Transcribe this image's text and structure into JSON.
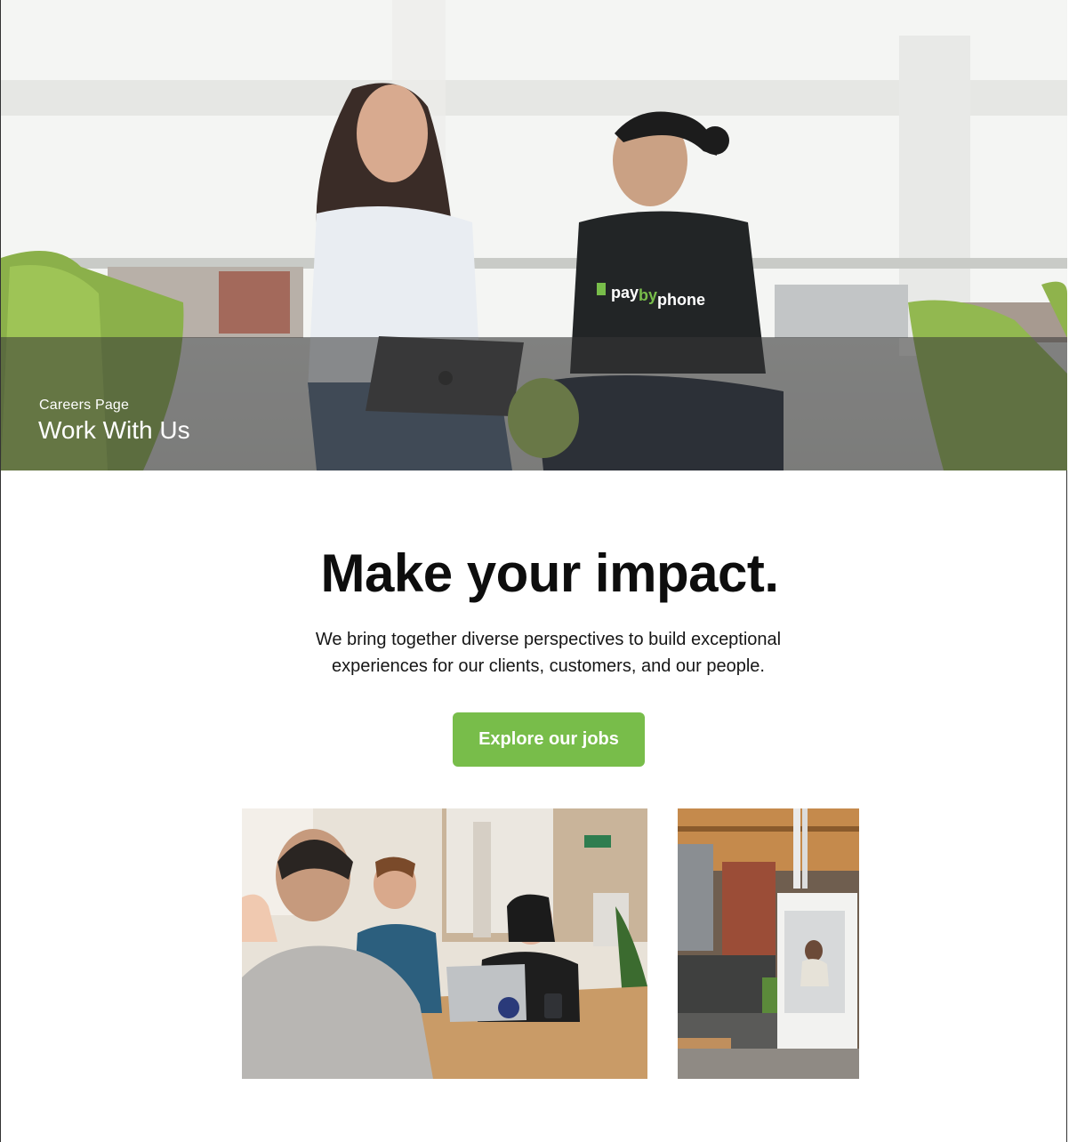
{
  "hero": {
    "eyebrow": "Careers Page",
    "title": "Work With Us",
    "image": "two-colleagues-laughing-with-laptop-photo",
    "shirt_logo": {
      "pay": "pay",
      "by": "by",
      "phone": "phone"
    }
  },
  "main": {
    "headline": "Make your impact.",
    "intro_lines": [
      "We bring together diverse perspectives to build exceptional",
      "experiences for our clients, customers, and our people."
    ],
    "cta_label": "Explore our jobs"
  },
  "gallery": {
    "photo_1": "team-meeting-at-table-photo",
    "photo_2": "office-phone-booth-photo"
  },
  "colors": {
    "accent": "#78bd4a",
    "band": "#373737",
    "text": "#111111"
  }
}
